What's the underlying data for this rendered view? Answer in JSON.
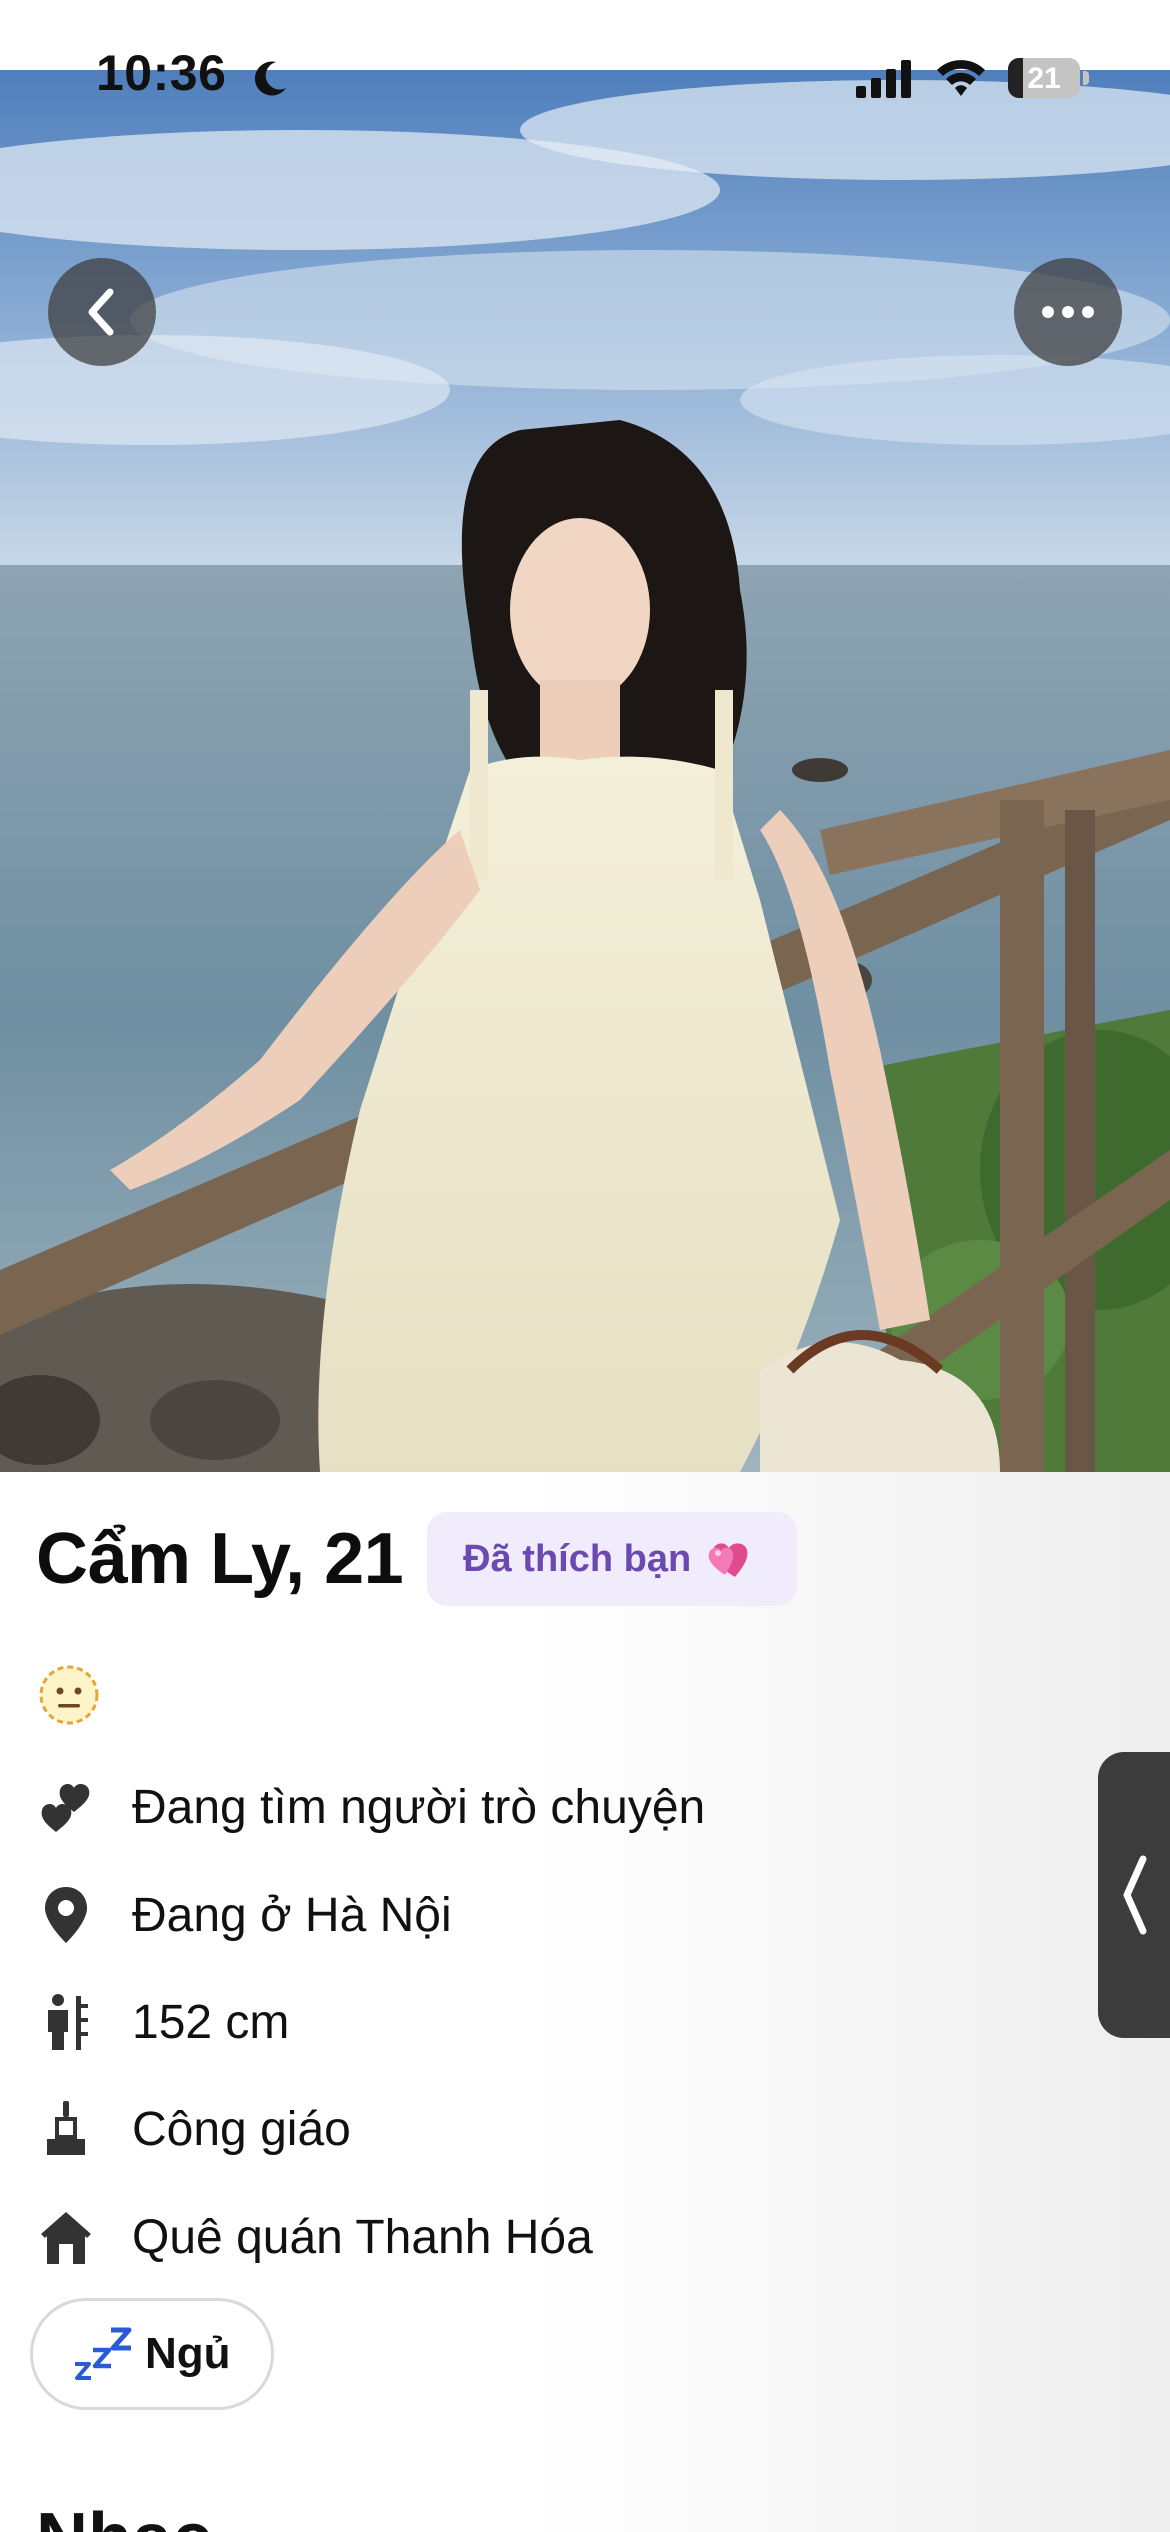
{
  "status_bar": {
    "time": "10:36",
    "battery_level": "21",
    "battery_fraction": 0.21
  },
  "photo": {
    "back_icon": "chevron-left-icon",
    "more_icon": "more-horizontal-icon"
  },
  "profile": {
    "name_age": "Cẩm Ly, 21",
    "liked_badge": "Đã thích bạn",
    "liked_badge_icon": "heart-icon",
    "liked_badge_color": "#6a4ab0",
    "liked_badge_bg": "#f1ecfb",
    "emoji_icon": "neutral-face-icon",
    "attributes": [
      {
        "icon": "hearts-icon",
        "label": "Đang tìm người trò chuyện"
      },
      {
        "icon": "location-pin-icon",
        "label": "Đang ở Hà Nội"
      },
      {
        "icon": "height-icon",
        "label": "152 cm"
      },
      {
        "icon": "religion-icon",
        "label": "Công giáo"
      },
      {
        "icon": "home-icon",
        "label": "Quê quán Thanh Hóa"
      }
    ],
    "tags": [
      {
        "icon": "zzz-icon",
        "label": "Ngủ"
      }
    ],
    "next_section_title": "Nhạc"
  },
  "side_handle": {
    "icon": "chevron-left-icon"
  }
}
